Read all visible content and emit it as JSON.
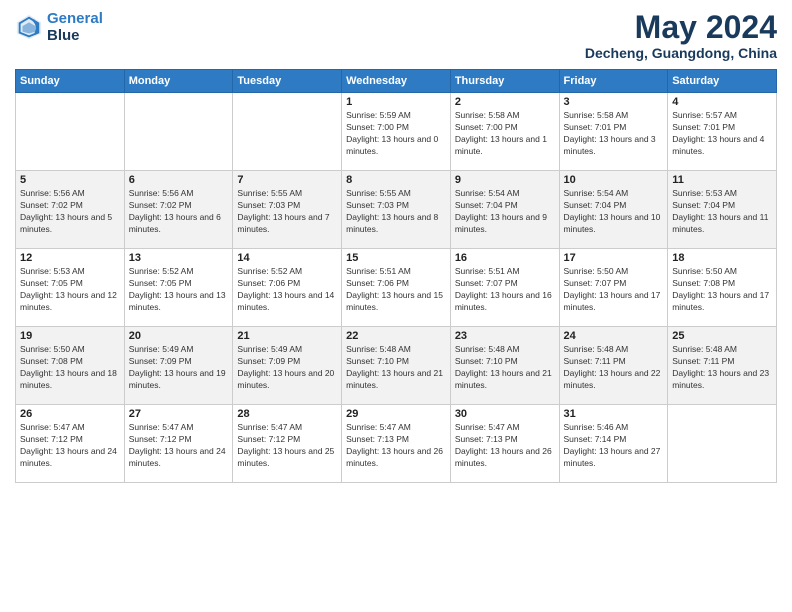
{
  "header": {
    "logo_line1": "General",
    "logo_line2": "Blue",
    "month_title": "May 2024",
    "location": "Decheng, Guangdong, China"
  },
  "weekdays": [
    "Sunday",
    "Monday",
    "Tuesday",
    "Wednesday",
    "Thursday",
    "Friday",
    "Saturday"
  ],
  "weeks": [
    [
      {
        "day": "",
        "sunrise": "",
        "sunset": "",
        "daylight": ""
      },
      {
        "day": "",
        "sunrise": "",
        "sunset": "",
        "daylight": ""
      },
      {
        "day": "",
        "sunrise": "",
        "sunset": "",
        "daylight": ""
      },
      {
        "day": "1",
        "sunrise": "Sunrise: 5:59 AM",
        "sunset": "Sunset: 7:00 PM",
        "daylight": "Daylight: 13 hours and 0 minutes."
      },
      {
        "day": "2",
        "sunrise": "Sunrise: 5:58 AM",
        "sunset": "Sunset: 7:00 PM",
        "daylight": "Daylight: 13 hours and 1 minute."
      },
      {
        "day": "3",
        "sunrise": "Sunrise: 5:58 AM",
        "sunset": "Sunset: 7:01 PM",
        "daylight": "Daylight: 13 hours and 3 minutes."
      },
      {
        "day": "4",
        "sunrise": "Sunrise: 5:57 AM",
        "sunset": "Sunset: 7:01 PM",
        "daylight": "Daylight: 13 hours and 4 minutes."
      }
    ],
    [
      {
        "day": "5",
        "sunrise": "Sunrise: 5:56 AM",
        "sunset": "Sunset: 7:02 PM",
        "daylight": "Daylight: 13 hours and 5 minutes."
      },
      {
        "day": "6",
        "sunrise": "Sunrise: 5:56 AM",
        "sunset": "Sunset: 7:02 PM",
        "daylight": "Daylight: 13 hours and 6 minutes."
      },
      {
        "day": "7",
        "sunrise": "Sunrise: 5:55 AM",
        "sunset": "Sunset: 7:03 PM",
        "daylight": "Daylight: 13 hours and 7 minutes."
      },
      {
        "day": "8",
        "sunrise": "Sunrise: 5:55 AM",
        "sunset": "Sunset: 7:03 PM",
        "daylight": "Daylight: 13 hours and 8 minutes."
      },
      {
        "day": "9",
        "sunrise": "Sunrise: 5:54 AM",
        "sunset": "Sunset: 7:04 PM",
        "daylight": "Daylight: 13 hours and 9 minutes."
      },
      {
        "day": "10",
        "sunrise": "Sunrise: 5:54 AM",
        "sunset": "Sunset: 7:04 PM",
        "daylight": "Daylight: 13 hours and 10 minutes."
      },
      {
        "day": "11",
        "sunrise": "Sunrise: 5:53 AM",
        "sunset": "Sunset: 7:04 PM",
        "daylight": "Daylight: 13 hours and 11 minutes."
      }
    ],
    [
      {
        "day": "12",
        "sunrise": "Sunrise: 5:53 AM",
        "sunset": "Sunset: 7:05 PM",
        "daylight": "Daylight: 13 hours and 12 minutes."
      },
      {
        "day": "13",
        "sunrise": "Sunrise: 5:52 AM",
        "sunset": "Sunset: 7:05 PM",
        "daylight": "Daylight: 13 hours and 13 minutes."
      },
      {
        "day": "14",
        "sunrise": "Sunrise: 5:52 AM",
        "sunset": "Sunset: 7:06 PM",
        "daylight": "Daylight: 13 hours and 14 minutes."
      },
      {
        "day": "15",
        "sunrise": "Sunrise: 5:51 AM",
        "sunset": "Sunset: 7:06 PM",
        "daylight": "Daylight: 13 hours and 15 minutes."
      },
      {
        "day": "16",
        "sunrise": "Sunrise: 5:51 AM",
        "sunset": "Sunset: 7:07 PM",
        "daylight": "Daylight: 13 hours and 16 minutes."
      },
      {
        "day": "17",
        "sunrise": "Sunrise: 5:50 AM",
        "sunset": "Sunset: 7:07 PM",
        "daylight": "Daylight: 13 hours and 17 minutes."
      },
      {
        "day": "18",
        "sunrise": "Sunrise: 5:50 AM",
        "sunset": "Sunset: 7:08 PM",
        "daylight": "Daylight: 13 hours and 17 minutes."
      }
    ],
    [
      {
        "day": "19",
        "sunrise": "Sunrise: 5:50 AM",
        "sunset": "Sunset: 7:08 PM",
        "daylight": "Daylight: 13 hours and 18 minutes."
      },
      {
        "day": "20",
        "sunrise": "Sunrise: 5:49 AM",
        "sunset": "Sunset: 7:09 PM",
        "daylight": "Daylight: 13 hours and 19 minutes."
      },
      {
        "day": "21",
        "sunrise": "Sunrise: 5:49 AM",
        "sunset": "Sunset: 7:09 PM",
        "daylight": "Daylight: 13 hours and 20 minutes."
      },
      {
        "day": "22",
        "sunrise": "Sunrise: 5:48 AM",
        "sunset": "Sunset: 7:10 PM",
        "daylight": "Daylight: 13 hours and 21 minutes."
      },
      {
        "day": "23",
        "sunrise": "Sunrise: 5:48 AM",
        "sunset": "Sunset: 7:10 PM",
        "daylight": "Daylight: 13 hours and 21 minutes."
      },
      {
        "day": "24",
        "sunrise": "Sunrise: 5:48 AM",
        "sunset": "Sunset: 7:11 PM",
        "daylight": "Daylight: 13 hours and 22 minutes."
      },
      {
        "day": "25",
        "sunrise": "Sunrise: 5:48 AM",
        "sunset": "Sunset: 7:11 PM",
        "daylight": "Daylight: 13 hours and 23 minutes."
      }
    ],
    [
      {
        "day": "26",
        "sunrise": "Sunrise: 5:47 AM",
        "sunset": "Sunset: 7:12 PM",
        "daylight": "Daylight: 13 hours and 24 minutes."
      },
      {
        "day": "27",
        "sunrise": "Sunrise: 5:47 AM",
        "sunset": "Sunset: 7:12 PM",
        "daylight": "Daylight: 13 hours and 24 minutes."
      },
      {
        "day": "28",
        "sunrise": "Sunrise: 5:47 AM",
        "sunset": "Sunset: 7:12 PM",
        "daylight": "Daylight: 13 hours and 25 minutes."
      },
      {
        "day": "29",
        "sunrise": "Sunrise: 5:47 AM",
        "sunset": "Sunset: 7:13 PM",
        "daylight": "Daylight: 13 hours and 26 minutes."
      },
      {
        "day": "30",
        "sunrise": "Sunrise: 5:47 AM",
        "sunset": "Sunset: 7:13 PM",
        "daylight": "Daylight: 13 hours and 26 minutes."
      },
      {
        "day": "31",
        "sunrise": "Sunrise: 5:46 AM",
        "sunset": "Sunset: 7:14 PM",
        "daylight": "Daylight: 13 hours and 27 minutes."
      },
      {
        "day": "",
        "sunrise": "",
        "sunset": "",
        "daylight": ""
      }
    ]
  ]
}
